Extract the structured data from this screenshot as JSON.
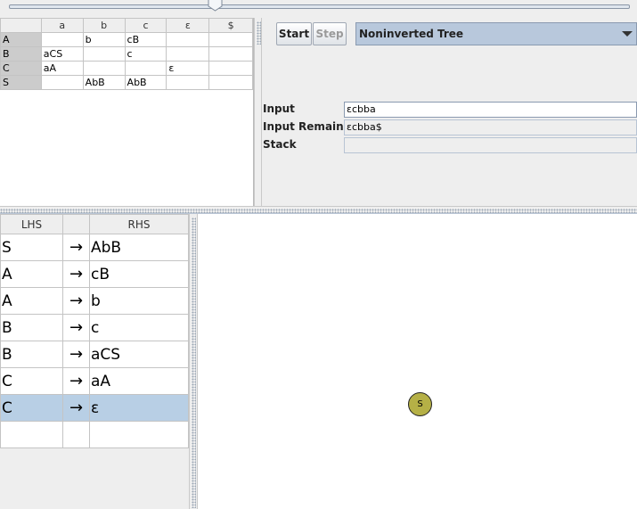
{
  "parse_table": {
    "columns": [
      "",
      "a",
      "b",
      "c",
      "ε",
      "$"
    ],
    "rows": [
      {
        "head": "A",
        "cells": [
          "",
          "b",
          "cB",
          "",
          ""
        ]
      },
      {
        "head": "B",
        "cells": [
          "aCS",
          "",
          "c",
          "",
          ""
        ]
      },
      {
        "head": "C",
        "cells": [
          "aA",
          "",
          "",
          "ε",
          ""
        ]
      },
      {
        "head": "S",
        "cells": [
          "",
          "AbB",
          "AbB",
          "",
          ""
        ]
      }
    ]
  },
  "controls": {
    "start_label": "Start",
    "step_label": "Step",
    "view_mode": "Noninverted Tree",
    "input_label": "Input",
    "input_value": "εcbba",
    "remaining_label": "Input Remaining",
    "remaining_value": "εcbba$",
    "stack_label": "Stack",
    "stack_value": ""
  },
  "grammar": {
    "headers": [
      "LHS",
      "",
      "RHS"
    ],
    "rows": [
      {
        "lhs": "S",
        "arrow": "→",
        "rhs": "AbB"
      },
      {
        "lhs": "A",
        "arrow": "→",
        "rhs": "cB"
      },
      {
        "lhs": "A",
        "arrow": "→",
        "rhs": "b"
      },
      {
        "lhs": "B",
        "arrow": "→",
        "rhs": "c"
      },
      {
        "lhs": "B",
        "arrow": "→",
        "rhs": "aCS"
      },
      {
        "lhs": "C",
        "arrow": "→",
        "rhs": "aA"
      },
      {
        "lhs": "C",
        "arrow": "→",
        "rhs": "ε"
      },
      {
        "lhs": "",
        "arrow": "",
        "rhs": ""
      }
    ],
    "selected_row": 6
  },
  "tree": {
    "root_label": "S",
    "node_color": "#b5b046"
  },
  "colors": {
    "selection": "#b8cfe5",
    "combo": "#b8c8dc"
  }
}
